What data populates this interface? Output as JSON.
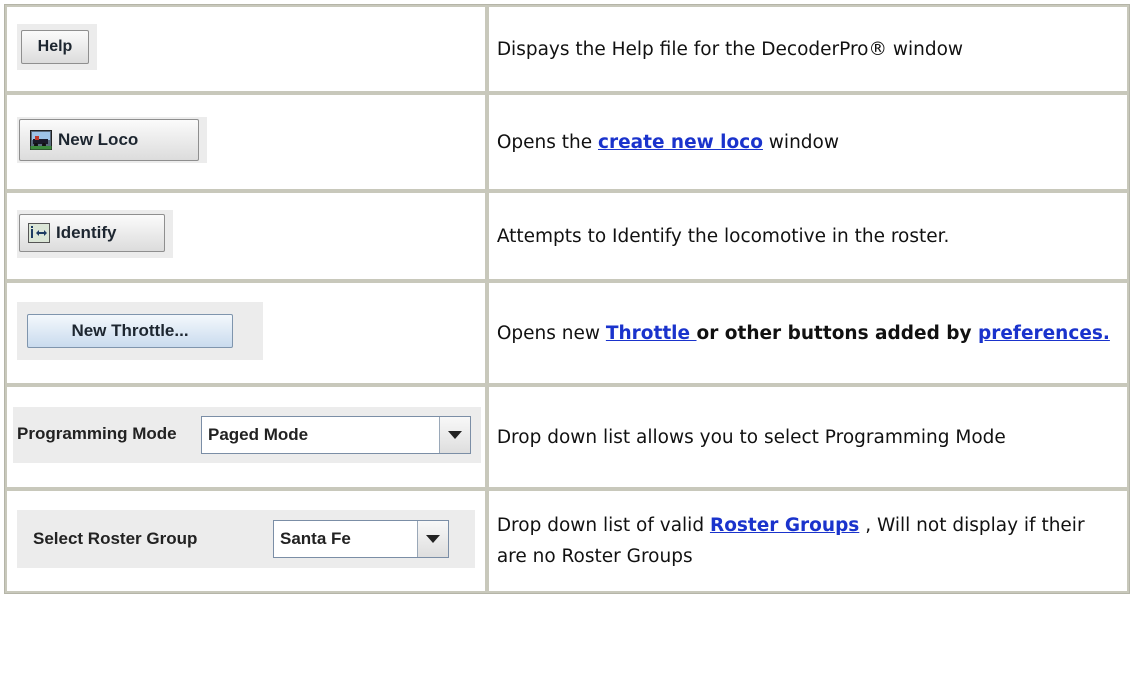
{
  "rows": [
    {
      "button": {
        "label": "Help"
      },
      "description": "Dispays the Help file for the DecoderPro® window"
    },
    {
      "button": {
        "label": "New Loco",
        "icon": "locomotive-icon"
      },
      "description": {
        "before": "Opens the ",
        "link": "create new loco",
        "after": " window"
      }
    },
    {
      "button": {
        "label": "Identify",
        "icon": "identify-arrows-icon"
      },
      "description": "Attempts to Identify the locomotive in the roster."
    },
    {
      "button": {
        "label": "New Throttle..."
      },
      "description": {
        "before": "Opens new ",
        "link": "Throttle ",
        "mid": "or other buttons added by ",
        "link2": "preferences."
      }
    },
    {
      "control": {
        "label": "Programming Mode",
        "value": "Paged Mode"
      },
      "description": "Drop down list allows you to select Programming Mode"
    },
    {
      "control": {
        "label": "Select Roster Group",
        "value": "Santa Fe"
      },
      "description": {
        "before": "Drop down list of valid ",
        "link": "Roster Groups",
        "after": " , Will not display if their are no Roster Groups"
      }
    }
  ]
}
